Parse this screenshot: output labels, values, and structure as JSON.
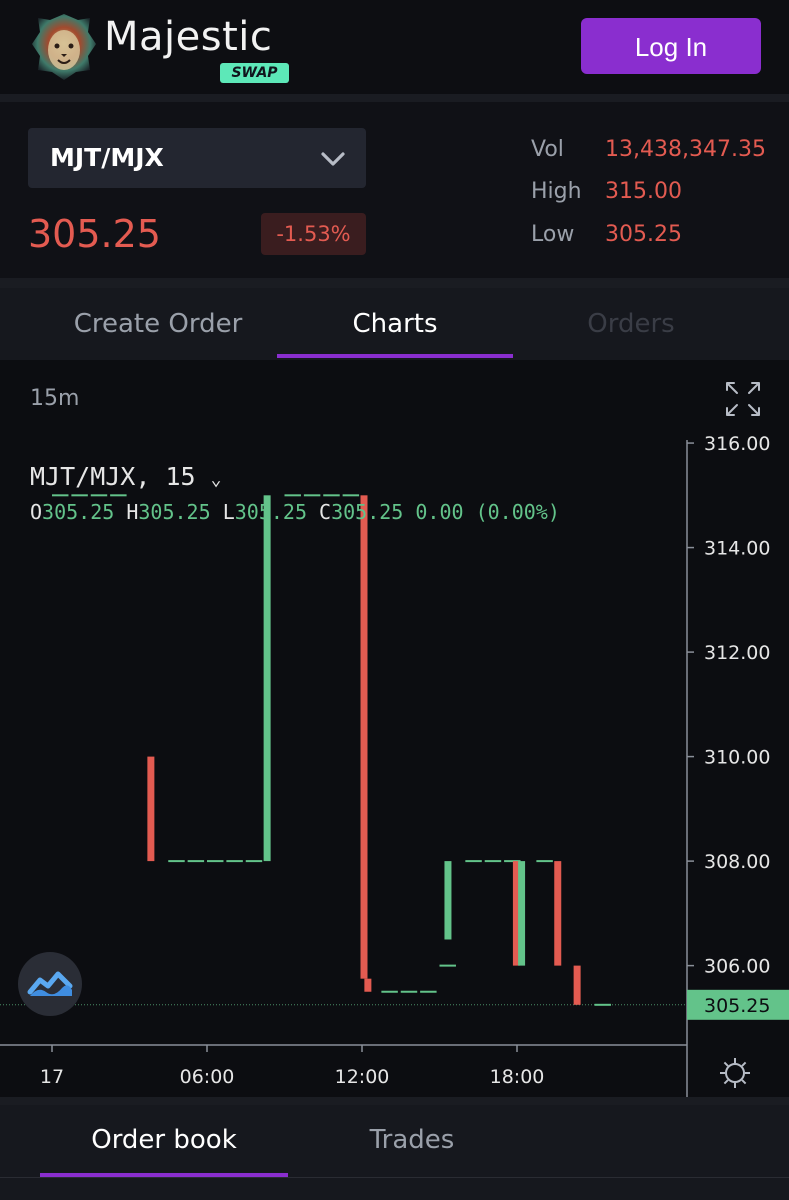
{
  "header": {
    "brand": "Majestic",
    "badge": "SWAP",
    "login_label": "Log In"
  },
  "ticker": {
    "pair": "MJT/MJX",
    "price": "305.25",
    "change": "-1.53%",
    "stats": [
      {
        "label": "Vol",
        "value": "13,438,347.35"
      },
      {
        "label": "High",
        "value": "315.00"
      },
      {
        "label": "Low",
        "value": "305.25"
      }
    ]
  },
  "tabs": [
    {
      "label": "Create Order",
      "state": "inactive"
    },
    {
      "label": "Charts",
      "state": "active"
    },
    {
      "label": "Orders",
      "state": "disabled"
    }
  ],
  "chart": {
    "interval": "15m",
    "legend_title": "MJT/MJX, 15",
    "ohlc": {
      "o": "305.25",
      "h": "305.25",
      "l": "305.25",
      "c": "305.25",
      "change": "0.00 (0.00%)"
    },
    "colors": {
      "up": "#63c38a",
      "down": "#e35b51",
      "last_price_bg": "#63c38a"
    }
  },
  "chart_data": {
    "type": "candlestick",
    "y_ticks": [
      "316.00",
      "314.00",
      "312.00",
      "310.00",
      "308.00",
      "306.00"
    ],
    "y_range": [
      304.5,
      316.25
    ],
    "x_ticks": [
      "17",
      "06:00",
      "12:00",
      "18:00"
    ],
    "last_price": "305.25",
    "candles": [
      {
        "t": 0.0,
        "o": 315.0,
        "h": 315.0,
        "l": 315.0,
        "c": 315.0
      },
      {
        "t": 0.75,
        "o": 315.0,
        "h": 315.0,
        "l": 315.0,
        "c": 315.0
      },
      {
        "t": 1.5,
        "o": 315.0,
        "h": 315.0,
        "l": 315.0,
        "c": 315.0
      },
      {
        "t": 2.25,
        "o": 315.0,
        "h": 315.0,
        "l": 315.0,
        "c": 315.0
      },
      {
        "t": 3.75,
        "o": 310.0,
        "h": 310.0,
        "l": 308.0,
        "c": 308.0
      },
      {
        "t": 4.5,
        "o": 308.0,
        "h": 308.0,
        "l": 308.0,
        "c": 308.0
      },
      {
        "t": 5.25,
        "o": 308.0,
        "h": 308.0,
        "l": 308.0,
        "c": 308.0
      },
      {
        "t": 6.0,
        "o": 308.0,
        "h": 308.0,
        "l": 308.0,
        "c": 308.0
      },
      {
        "t": 6.75,
        "o": 308.0,
        "h": 308.0,
        "l": 308.0,
        "c": 308.0
      },
      {
        "t": 7.5,
        "o": 308.0,
        "h": 308.0,
        "l": 308.0,
        "c": 308.0
      },
      {
        "t": 8.25,
        "o": 308.0,
        "h": 315.0,
        "l": 308.0,
        "c": 315.0
      },
      {
        "t": 9.0,
        "o": 315.0,
        "h": 315.0,
        "l": 315.0,
        "c": 315.0
      },
      {
        "t": 9.75,
        "o": 315.0,
        "h": 315.0,
        "l": 315.0,
        "c": 315.0
      },
      {
        "t": 10.5,
        "o": 315.0,
        "h": 315.0,
        "l": 315.0,
        "c": 315.0
      },
      {
        "t": 11.25,
        "o": 315.0,
        "h": 315.0,
        "l": 315.0,
        "c": 315.0
      },
      {
        "t": 12.0,
        "o": 315.0,
        "h": 315.0,
        "l": 305.75,
        "c": 305.75
      },
      {
        "t": 12.15,
        "o": 305.75,
        "h": 305.75,
        "l": 305.5,
        "c": 305.5
      },
      {
        "t": 12.75,
        "o": 305.5,
        "h": 305.5,
        "l": 305.5,
        "c": 305.5
      },
      {
        "t": 13.5,
        "o": 305.5,
        "h": 305.5,
        "l": 305.5,
        "c": 305.5
      },
      {
        "t": 14.25,
        "o": 305.5,
        "h": 305.5,
        "l": 305.5,
        "c": 305.5
      },
      {
        "t": 15.0,
        "o": 306.0,
        "h": 306.0,
        "l": 306.0,
        "c": 306.0
      },
      {
        "t": 15.25,
        "o": 306.5,
        "h": 308.0,
        "l": 306.5,
        "c": 308.0
      },
      {
        "t": 16.0,
        "o": 308.0,
        "h": 308.0,
        "l": 308.0,
        "c": 308.0
      },
      {
        "t": 16.75,
        "o": 308.0,
        "h": 308.0,
        "l": 308.0,
        "c": 308.0
      },
      {
        "t": 17.5,
        "o": 308.0,
        "h": 308.0,
        "l": 308.0,
        "c": 308.0
      },
      {
        "t": 17.9,
        "o": 308.0,
        "h": 308.0,
        "l": 306.0,
        "c": 306.0
      },
      {
        "t": 18.1,
        "o": 306.0,
        "h": 308.0,
        "l": 306.0,
        "c": 308.0
      },
      {
        "t": 18.75,
        "o": 308.0,
        "h": 308.0,
        "l": 308.0,
        "c": 308.0
      },
      {
        "t": 19.5,
        "o": 308.0,
        "h": 308.0,
        "l": 306.0,
        "c": 306.0
      },
      {
        "t": 20.25,
        "o": 306.0,
        "h": 306.0,
        "l": 305.25,
        "c": 305.25
      },
      {
        "t": 21.0,
        "o": 305.25,
        "h": 305.25,
        "l": 305.25,
        "c": 305.25
      }
    ]
  },
  "bottom_tabs": [
    {
      "label": "Order book",
      "state": "active"
    },
    {
      "label": "Trades",
      "state": "inactive"
    }
  ]
}
